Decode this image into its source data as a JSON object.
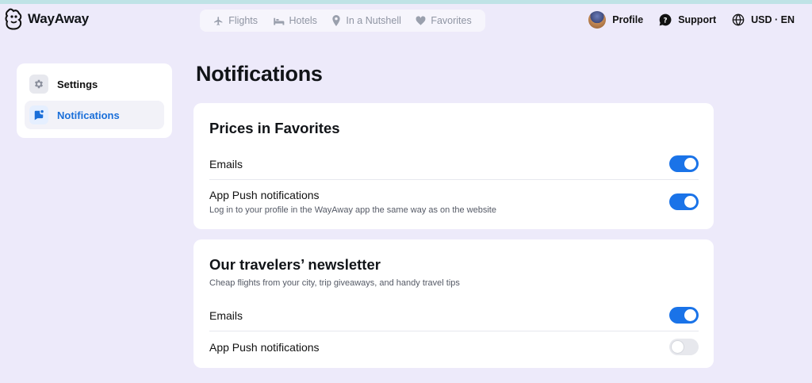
{
  "header": {
    "brand": "WayAway",
    "nav": [
      {
        "label": "Flights",
        "icon": "plane-icon"
      },
      {
        "label": "Hotels",
        "icon": "bed-icon"
      },
      {
        "label": "In a Nutshell",
        "icon": "location-pin-icon"
      },
      {
        "label": "Favorites",
        "icon": "heart-icon"
      }
    ],
    "profile_label": "Profile",
    "support_label": "Support",
    "locale_label": "USD · EN"
  },
  "sidebar": {
    "items": [
      {
        "label": "Settings",
        "icon": "gear-icon",
        "active": false
      },
      {
        "label": "Notifications",
        "icon": "notification-icon",
        "active": true
      }
    ]
  },
  "main": {
    "title": "Notifications",
    "cards": [
      {
        "title": "Prices in Favorites",
        "rows": [
          {
            "label": "Emails",
            "enabled": true
          },
          {
            "label": "App Push notifications",
            "description": "Log in to your profile in the WayAway app the same way as on the website",
            "enabled": true
          }
        ]
      },
      {
        "title": "Our travelers’ newsletter",
        "subtitle": "Cheap flights from your city, trip giveaways, and handy travel tips",
        "rows": [
          {
            "label": "Emails",
            "enabled": true
          },
          {
            "label": "App Push notifications",
            "enabled": false
          }
        ]
      }
    ]
  },
  "colors": {
    "accent": "#1a73e8",
    "background": "#edeafa",
    "active_text": "#1a6fd9"
  }
}
